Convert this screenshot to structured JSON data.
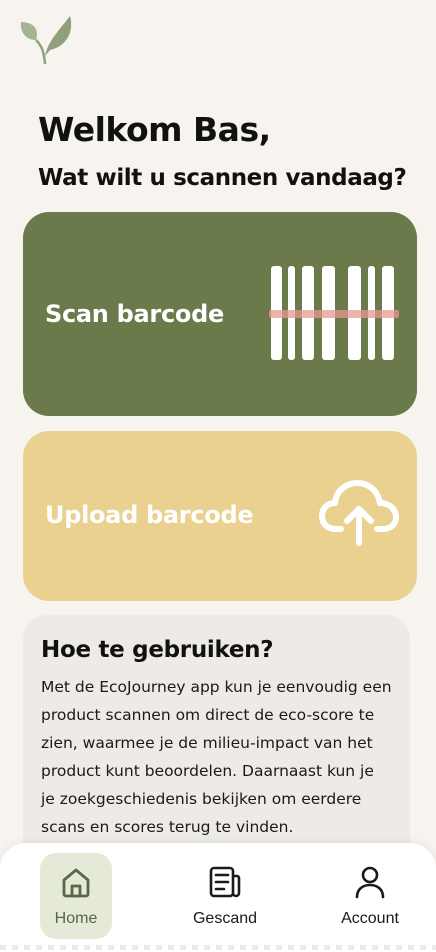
{
  "header": {
    "logo_icon": "leaf-logo-icon",
    "welcome": "Welkom Bas,",
    "subtitle": "Wat wilt u scannen vandaag?"
  },
  "actions": {
    "scan": {
      "label": "Scan barcode",
      "icon": "barcode-scan-icon",
      "color": "#6a7a4b"
    },
    "upload": {
      "label": "Upload barcode",
      "icon": "cloud-upload-icon",
      "color": "#ead18f"
    }
  },
  "howto": {
    "title": "Hoe te gebruiken?",
    "body": "Met de EcoJourney app kun je eenvoudig een product scannen om direct de eco-score te zien, waarmee je de milieu-impact van het product kunt beoordelen. Daarnaast kun je je zoekgeschiedenis bekijken om eerdere scans en scores terug te vinden."
  },
  "nav": {
    "items": [
      {
        "label": "Home",
        "icon": "home-icon",
        "active": true
      },
      {
        "label": "Gescand",
        "icon": "document-icon",
        "active": false
      },
      {
        "label": "Account",
        "icon": "user-icon",
        "active": false
      }
    ],
    "active_color": "#e5ead8"
  }
}
